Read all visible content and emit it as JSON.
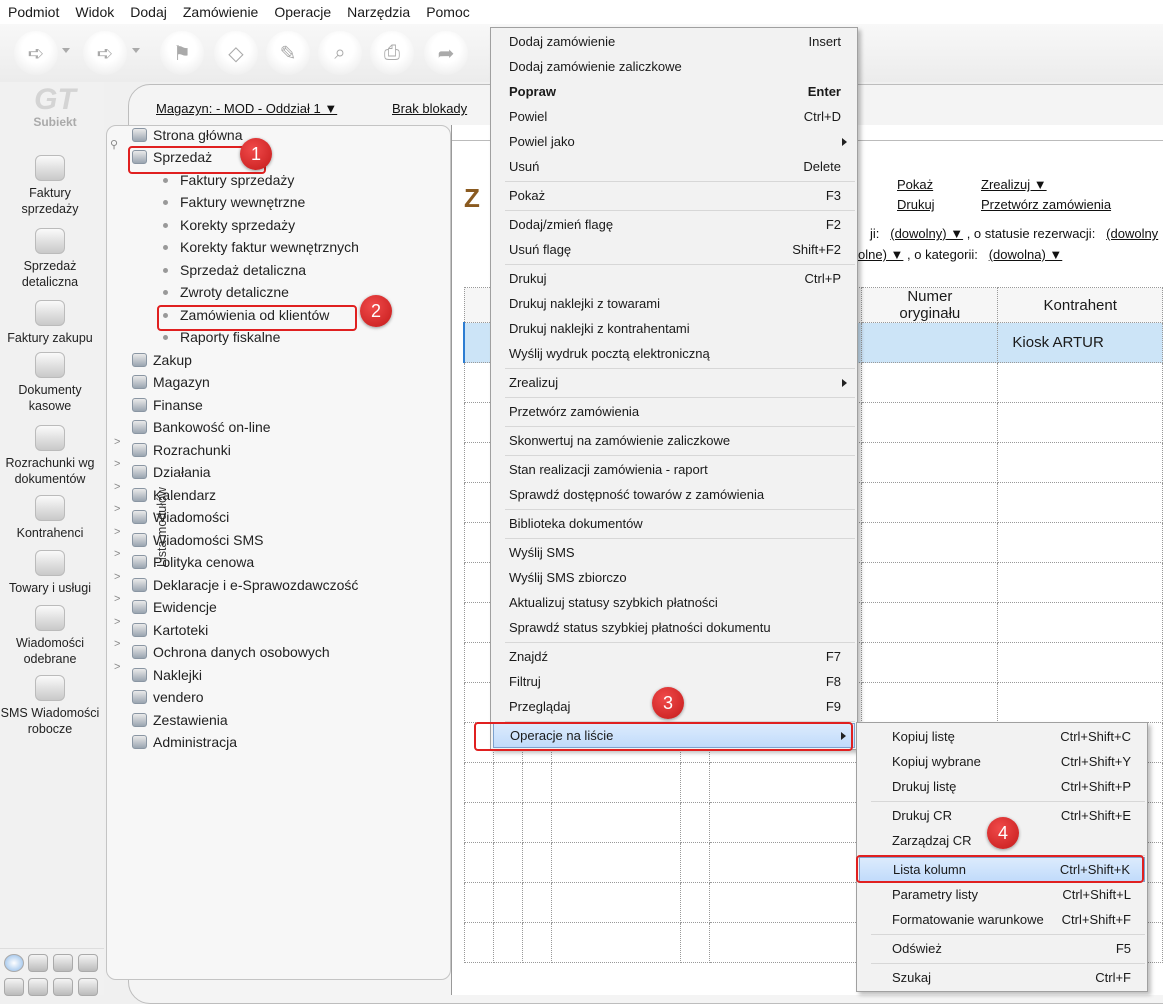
{
  "menubar": [
    "Podmiot",
    "Widok",
    "Dodaj",
    "Zamówienie",
    "Operacje",
    "Narzędzia",
    "Pomoc"
  ],
  "logo": {
    "mark": "GT",
    "name": "Subiekt"
  },
  "topbar": {
    "warehouse": "Magazyn: - MOD - Oddział 1 ▼",
    "lock": "Brak blokady"
  },
  "sidebar": [
    {
      "label": "Faktury sprzedaży",
      "icon": "invoice-icon"
    },
    {
      "label": "Sprzedaż detaliczna",
      "icon": "cash-register-icon"
    },
    {
      "label": "Faktury zakupu",
      "icon": "purchase-invoice-icon"
    },
    {
      "label": "Dokumenty kasowe",
      "icon": "cash-documents-icon"
    },
    {
      "label": "Rozrachunki wg dokumentów",
      "icon": "settlements-icon"
    },
    {
      "label": "Kontrahenci",
      "icon": "contractors-icon"
    },
    {
      "label": "Towary i usługi",
      "icon": "products-icon"
    },
    {
      "label": "Wiadomości odebrane",
      "icon": "messages-icon"
    },
    {
      "label": "SMS Wiadomości robocze",
      "icon": "sms-icon"
    }
  ],
  "modules_label": "Lista modułów",
  "tree": [
    {
      "label": "Strona główna",
      "level": 0
    },
    {
      "label": "Sprzedaż",
      "level": 0
    },
    {
      "label": "Faktury sprzedaży",
      "level": 1
    },
    {
      "label": "Faktury wewnętrzne",
      "level": 1
    },
    {
      "label": "Korekty sprzedaży",
      "level": 1
    },
    {
      "label": "Korekty faktur wewnętrznych",
      "level": 1
    },
    {
      "label": "Sprzedaż detaliczna",
      "level": 1
    },
    {
      "label": "Zwroty detaliczne",
      "level": 1
    },
    {
      "label": "Zamówienia od klientów",
      "level": 1
    },
    {
      "label": "Raporty fiskalne",
      "level": 1
    },
    {
      "label": "Zakup",
      "level": 0
    },
    {
      "label": "Magazyn",
      "level": 0
    },
    {
      "label": "Finanse",
      "level": 0
    },
    {
      "label": "Bankowość on-line",
      "level": 0
    },
    {
      "label": "Rozrachunki",
      "level": 0
    },
    {
      "label": "Działania",
      "level": 0
    },
    {
      "label": "Kalendarz",
      "level": 0
    },
    {
      "label": "Wiadomości",
      "level": 0
    },
    {
      "label": "Wiadomości SMS",
      "level": 0
    },
    {
      "label": "Polityka cenowa",
      "level": 0
    },
    {
      "label": "Deklaracje i e-Sprawozdawczość",
      "level": 0
    },
    {
      "label": "Ewidencje",
      "level": 0
    },
    {
      "label": "Kartoteki",
      "level": 0
    },
    {
      "label": "Ochrona danych osobowych",
      "level": 0
    },
    {
      "label": "Naklejki",
      "level": 0
    },
    {
      "label": "vendero",
      "level": 0
    },
    {
      "label": "Zestawienia",
      "level": 0
    },
    {
      "label": "Administracja",
      "level": 0
    }
  ],
  "content": {
    "title_fragment": "Z",
    "links": {
      "show": "Pokaż",
      "realize": "Zrealizuj ▼",
      "print": "Drukuj",
      "process": "Przetwórz zamówienia"
    },
    "filter1": {
      "prefix": "ji:",
      "v1": "(dowolny) ▼",
      ", o statusie rezerwacji:": "",
      "mid": ", o statusie rezerwacji:",
      "v2": "(dowolny"
    },
    "filter2": {
      "v1": "olne) ▼",
      "mid": ", o kategorii:",
      "v2": "(dowolna) ▼"
    },
    "columns": [
      "",
      "",
      "",
      "",
      "",
      "",
      "Numer oryginału",
      "Kontrahent"
    ],
    "selected_row_contractor": "Kiosk ARTUR"
  },
  "context_menu": [
    {
      "label": "Dodaj zamówienie",
      "shortcut": "Insert"
    },
    {
      "label": "Dodaj zamówienie zaliczkowe",
      "shortcut": ""
    },
    {
      "label": "Popraw",
      "shortcut": "Enter",
      "bold": true
    },
    {
      "label": "Powiel",
      "shortcut": "Ctrl+D"
    },
    {
      "label": "Powiel jako",
      "shortcut": "",
      "submenu": true
    },
    {
      "label": "Usuń",
      "shortcut": "Delete",
      "sep": true
    },
    {
      "label": "Pokaż",
      "shortcut": "F3",
      "sep": true
    },
    {
      "label": "Dodaj/zmień flagę",
      "shortcut": "F2"
    },
    {
      "label": "Usuń flagę",
      "shortcut": "Shift+F2",
      "sep": true
    },
    {
      "label": "Drukuj",
      "shortcut": "Ctrl+P"
    },
    {
      "label": "Drukuj naklejki z towarami",
      "shortcut": ""
    },
    {
      "label": "Drukuj naklejki z kontrahentami",
      "shortcut": ""
    },
    {
      "label": "Wyślij wydruk pocztą elektroniczną",
      "shortcut": "",
      "sep": true
    },
    {
      "label": "Zrealizuj",
      "shortcut": "",
      "submenu": true,
      "sep": true
    },
    {
      "label": "Przetwórz zamówienia",
      "shortcut": "",
      "sep": true
    },
    {
      "label": "Skonwertuj na zamówienie zaliczkowe",
      "shortcut": "",
      "sep": true
    },
    {
      "label": "Stan realizacji zamówienia - raport",
      "shortcut": ""
    },
    {
      "label": "Sprawdź dostępność towarów z zamówienia",
      "shortcut": "",
      "sep": true
    },
    {
      "label": "Biblioteka dokumentów",
      "shortcut": "",
      "sep": true
    },
    {
      "label": "Wyślij SMS",
      "shortcut": ""
    },
    {
      "label": "Wyślij SMS zbiorczo",
      "shortcut": ""
    },
    {
      "label": "Aktualizuj statusy szybkich płatności",
      "shortcut": ""
    },
    {
      "label": "Sprawdź status szybkiej płatności dokumentu",
      "shortcut": "",
      "sep": true
    },
    {
      "label": "Znajdź",
      "shortcut": "F7"
    },
    {
      "label": "Filtruj",
      "shortcut": "F8"
    },
    {
      "label": "Przeglądaj",
      "shortcut": "F9",
      "sep": true
    },
    {
      "label": "Operacje na liście",
      "shortcut": "",
      "submenu": true,
      "highlighted": true
    }
  ],
  "submenu": [
    {
      "label": "Kopiuj listę",
      "shortcut": "Ctrl+Shift+C"
    },
    {
      "label": "Kopiuj wybrane",
      "shortcut": "Ctrl+Shift+Y"
    },
    {
      "label": "Drukuj listę",
      "shortcut": "Ctrl+Shift+P",
      "sep": true
    },
    {
      "label": "Drukuj CR",
      "shortcut": "Ctrl+Shift+E"
    },
    {
      "label": "Zarządzaj CR",
      "shortcut": "",
      "sep": true
    },
    {
      "label": "Lista kolumn",
      "shortcut": "Ctrl+Shift+K",
      "highlighted": true
    },
    {
      "label": "Parametry listy",
      "shortcut": "Ctrl+Shift+L"
    },
    {
      "label": "Formatowanie warunkowe",
      "shortcut": "Ctrl+Shift+F",
      "sep": true
    },
    {
      "label": "Odśwież",
      "shortcut": "F5",
      "sep": true
    },
    {
      "label": "Szukaj",
      "shortcut": "Ctrl+F"
    }
  ],
  "badges": [
    "1",
    "2",
    "3",
    "4"
  ],
  "colors": {
    "badge": "#d9262b",
    "highlight_border": "#e02020",
    "selection": "#cce4f7"
  }
}
